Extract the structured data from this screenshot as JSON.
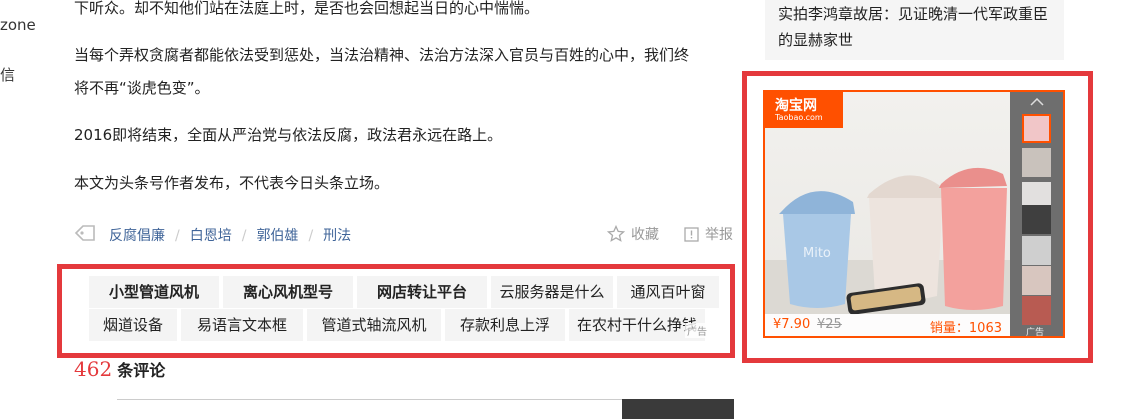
{
  "left_nav": [
    "zone",
    "信"
  ],
  "article": {
    "paragraphs": [
      "下听众。却不知他们站在法庭上时，是否也会回想起当日的心中惴惴。",
      "当每个弄权贪腐者都能依法受到惩处，当法治精神、法治方法深入官员与百姓的心中，我们终",
      "将不再“谈虎色变”。",
      "2016即将结束，全面从严治党与依法反腐，政法君永远在路上。",
      "本文为头条号作者发布，不代表今日头条立场。"
    ],
    "tags": [
      "反腐倡廉",
      "白恩培",
      "郭伯雄",
      "刑法"
    ],
    "collect_label": "收藏",
    "report_label": "举报"
  },
  "keywords": {
    "row1": [
      "小型管道风机",
      "离心风机型号",
      "网店转让平台",
      "云服务器是什么",
      "通风百叶窗"
    ],
    "row2": [
      "烟道设备",
      "易语言文本框",
      "管道式轴流风机",
      "存款利息上浮",
      "在农村干什么挣钱"
    ],
    "ad_mark": "广告"
  },
  "comments": {
    "count": "462",
    "label": "条评论"
  },
  "sidebar": {
    "related_title": "实拍李鸿章故居：见证晚清一代军政重臣的显赫家世"
  },
  "product_ad": {
    "brand": "淘宝网",
    "brand_sub": "Taobao.com",
    "price": "¥7.90",
    "original_price": "¥25",
    "sales": "销量：1063",
    "ad_label": "广告",
    "product_text": "Mito"
  }
}
